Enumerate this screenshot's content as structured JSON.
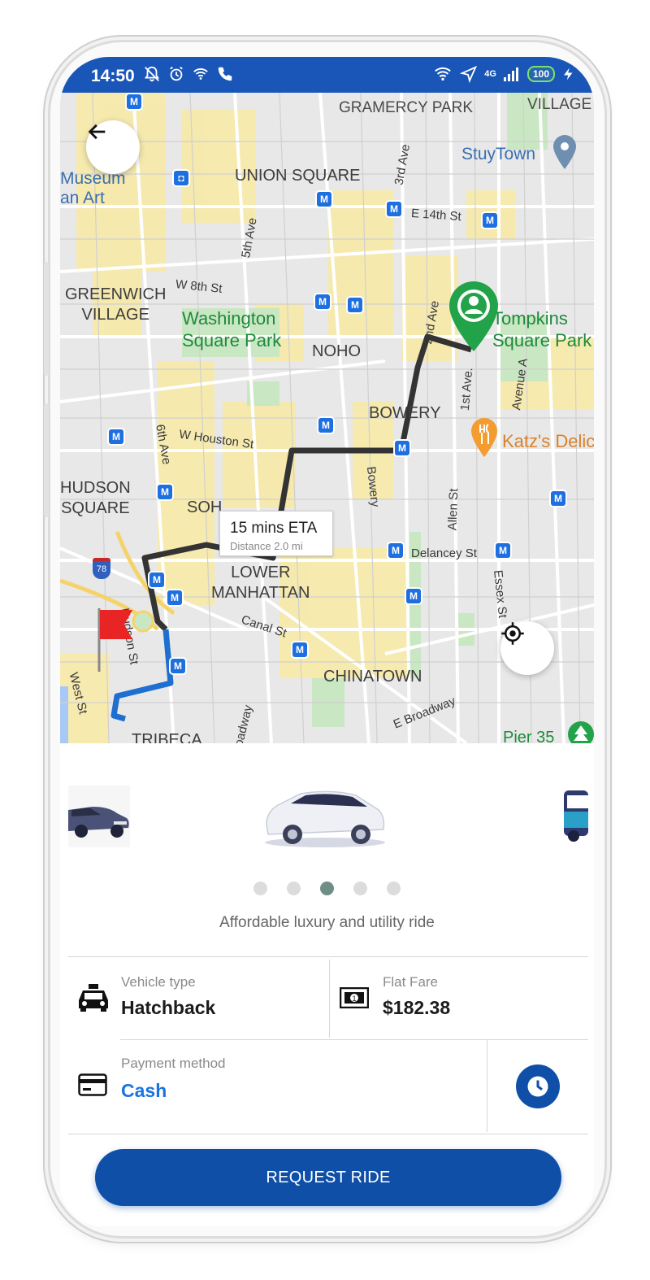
{
  "status_bar": {
    "time": "14:50",
    "battery": "100",
    "network": "4G"
  },
  "map": {
    "labels": {
      "gramercy": "GRAMERCY PARK",
      "village": "VILLAGE",
      "stuytown": "StuyTown",
      "museum1": "Museum",
      "museum2": "an Art",
      "union_square": "UNION SQUARE",
      "third_ave": "3rd Ave",
      "e14": "E 14th St",
      "fifth_ave": "5th Ave",
      "greenwich": "GREENWICH\nVILLAGE",
      "w8": "W 8th St",
      "washington": "Washington\nSquare Park",
      "noho": "NOHO",
      "second_ave": "2nd Ave",
      "tompkins": "Tompkins\nSquare Park",
      "first_ave": "1st Ave.",
      "avenue_a": "Avenue A",
      "bowery_area": "BOWERY",
      "katz": "Katz's Delic",
      "houston": "W Houston St",
      "sixth_ave": "6th Ave",
      "hudson_square": "HUDSON\nSQUARE",
      "soho": "SOH",
      "bowery_st": "Bowery",
      "allen": "Allen St",
      "delancey": "Delancey St",
      "essex": "Essex St",
      "lower_manhattan": "LOWER\nMANHATTAN",
      "canal": "Canal St",
      "hudson_st": "Hudson St",
      "west_st": "West St",
      "chinatown": "CHINATOWN",
      "broadway": "E Broadway",
      "tribeca": "TRIBECA",
      "broadway2": "oadway",
      "pier": "Pier 35",
      "i78": "78"
    },
    "eta": {
      "title": "15 mins ETA",
      "distance": "Distance 2.0 mi"
    }
  },
  "ride": {
    "tagline": "Affordable luxury and utility ride",
    "carousel_selected": 3,
    "vehicle_type_label": "Vehicle type",
    "vehicle_type": "Hatchback",
    "fare_label": "Flat Fare",
    "fare": "$182.38",
    "payment_label": "Payment method",
    "payment": "Cash",
    "request_button": "REQUEST RIDE"
  },
  "colors": {
    "brand": "#0f4fa8",
    "status_bar": "#1a56b8",
    "payment_blue": "#1a73e0",
    "route_dark": "#333333",
    "route_blue": "#1e6fd0"
  }
}
